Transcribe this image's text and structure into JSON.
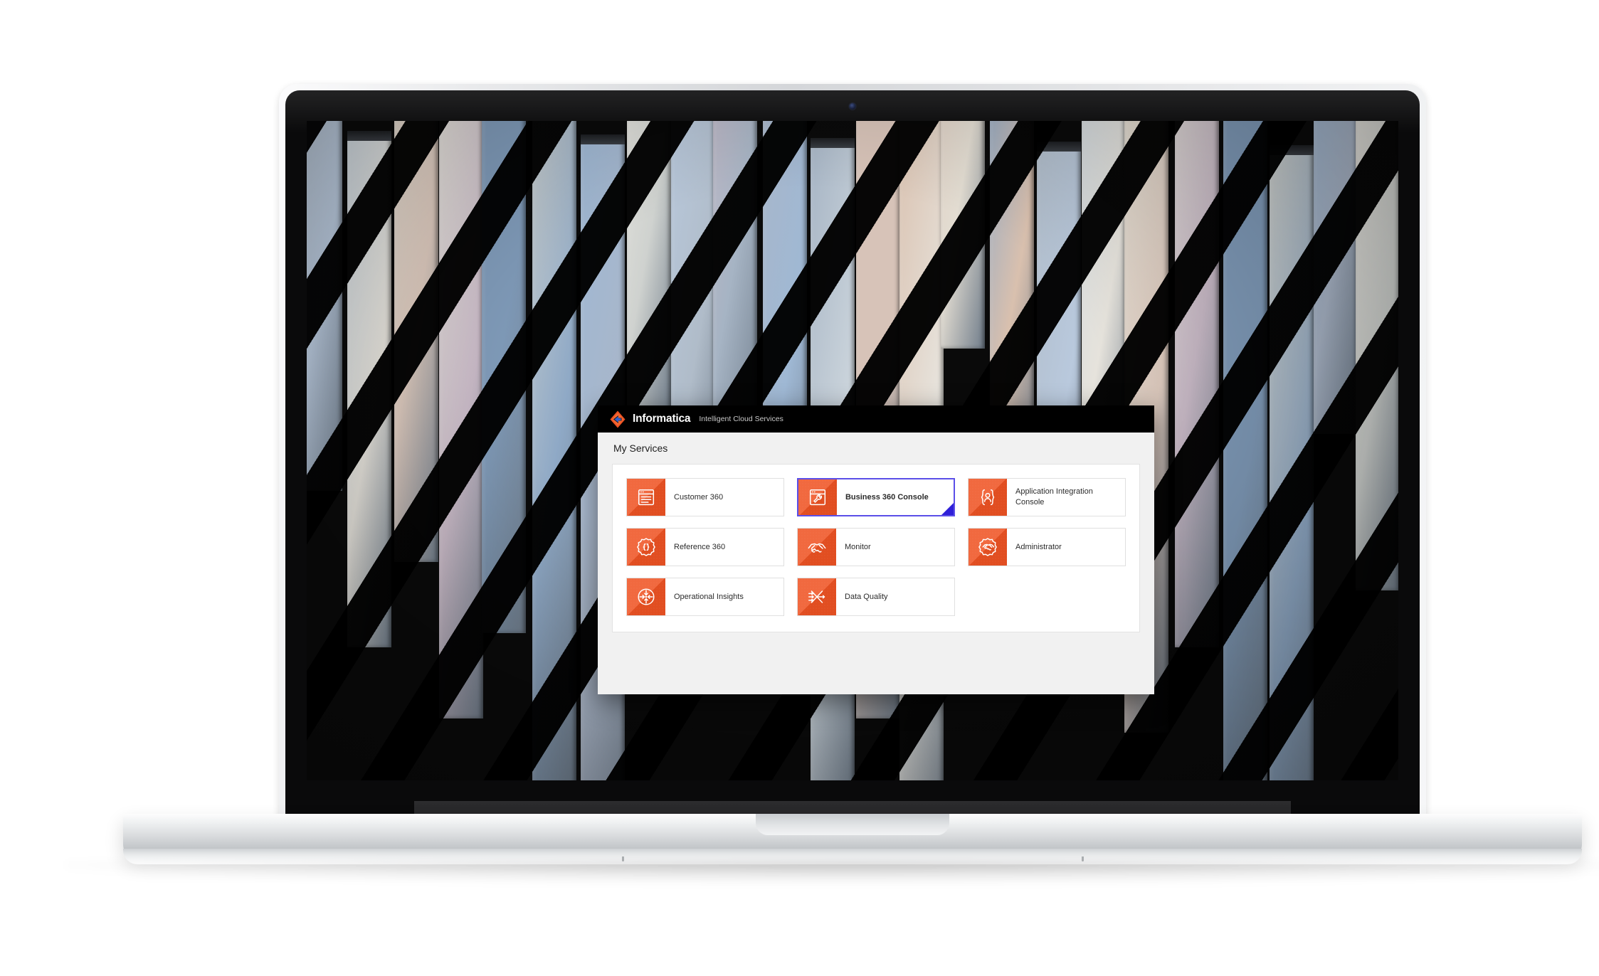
{
  "dialog": {
    "brand_name": "Informatica",
    "brand_tagline": "Intelligent Cloud Services",
    "logo_icon": "informatica-diamond-logo",
    "page_title": "My Services"
  },
  "colors": {
    "brand_orange": "#ef5323",
    "header_black": "#000000",
    "selection_purple": "#5b4fe8",
    "corner_flag_blue": "#2f20d8",
    "panel_white": "#ffffff",
    "dialog_grey": "#f1f1f1"
  },
  "services": {
    "rows": [
      [
        {
          "label": "Customer 360",
          "icon": "browser-list-icon",
          "selected": false
        },
        {
          "label": "Business 360 Console",
          "icon": "browser-wrench-icon",
          "selected": true
        },
        {
          "label": "Application Integration Console",
          "icon": "brackets-person-icon",
          "selected": false
        }
      ],
      [
        {
          "label": "Reference 360",
          "icon": "badge-braces-icon",
          "selected": false
        },
        {
          "label": "Monitor",
          "icon": "handshake-icon",
          "selected": false
        },
        {
          "label": "Administrator",
          "icon": "badge-handshake-icon",
          "selected": false
        }
      ],
      [
        {
          "label": "Operational Insights",
          "icon": "circle-inward-arrows-icon",
          "selected": false
        },
        {
          "label": "Data Quality",
          "icon": "funnel-merge-arrows-icon",
          "selected": false
        },
        {
          "label": "",
          "icon": "",
          "selected": false
        }
      ]
    ]
  }
}
